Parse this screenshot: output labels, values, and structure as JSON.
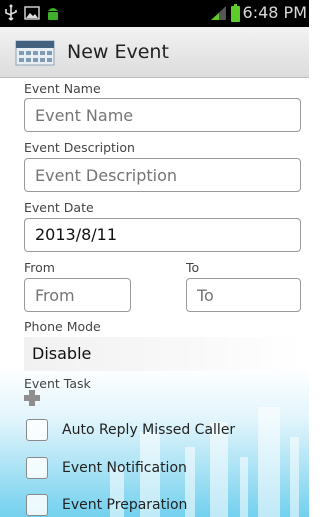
{
  "status_bar": {
    "time": "6:48 PM",
    "icons": [
      "usb-icon",
      "image-icon",
      "android-icon",
      "signal-icon",
      "battery-icon"
    ]
  },
  "header": {
    "title": "New Event",
    "icon": "calendar-icon"
  },
  "form": {
    "event_name": {
      "label": "Event Name",
      "value": "",
      "placeholder": "Event Name"
    },
    "event_description": {
      "label": "Event Description",
      "value": "",
      "placeholder": "Event Description"
    },
    "event_date": {
      "label": "Event Date",
      "value": "2013/8/11"
    },
    "from": {
      "label": "From",
      "value": "",
      "placeholder": "From"
    },
    "to": {
      "label": "To",
      "value": "",
      "placeholder": "To"
    },
    "phone_mode": {
      "label": "Phone Mode",
      "value": "Disable"
    },
    "event_task": {
      "label": "Event Task",
      "add_icon": "plus-icon"
    },
    "tasks": [
      {
        "label": "Auto Reply Missed Caller",
        "checked": false
      },
      {
        "label": "Event Notification",
        "checked": false
      },
      {
        "label": "Event Preparation",
        "checked": false
      }
    ]
  },
  "colors": {
    "status_bar": "#000000",
    "action_bar": "#e6e6e6",
    "battery": "#5ecb2c",
    "background_accent": "#5ac8eb"
  }
}
